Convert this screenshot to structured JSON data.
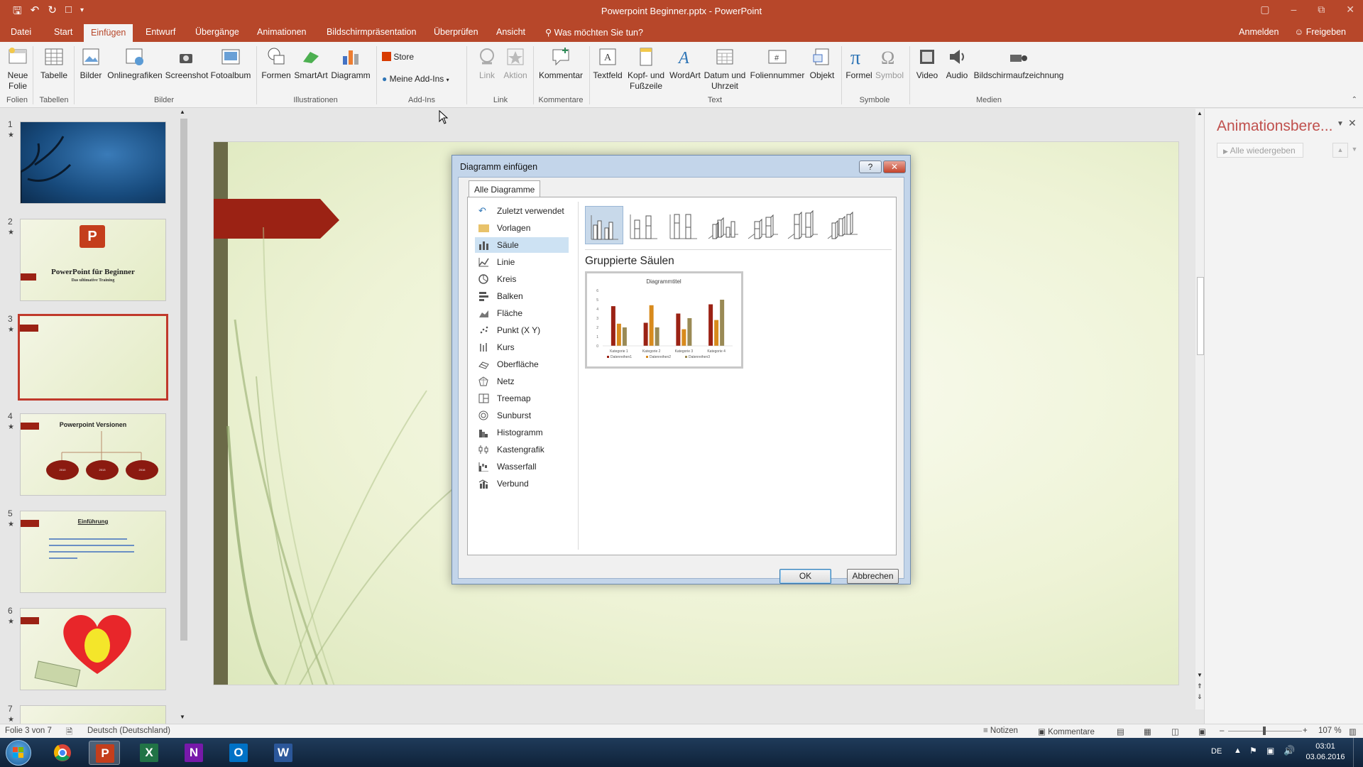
{
  "window": {
    "title": "Powerpoint Beginner.pptx - PowerPoint"
  },
  "tabs": {
    "items": [
      "Datei",
      "Start",
      "Einfügen",
      "Entwurf",
      "Übergänge",
      "Animationen",
      "Bildschirmpräsentation",
      "Überprüfen",
      "Ansicht"
    ],
    "tell_me": "Was möchten Sie tun?",
    "signin": "Anmelden",
    "share": "Freigeben"
  },
  "ribbon": {
    "buttons": {
      "neue_folie": "Neue Folie",
      "tabelle": "Tabelle",
      "bilder": "Bilder",
      "onlinegrafiken": "Onlinegrafiken",
      "screenshot": "Screenshot",
      "fotoalbum": "Fotoalbum",
      "formen": "Formen",
      "smartart": "SmartArt",
      "diagramm": "Diagramm",
      "store": "Store",
      "meine_addins": "Meine Add-Ins",
      "link": "Link",
      "aktion": "Aktion",
      "kommentar": "Kommentar",
      "textfeld": "Textfeld",
      "kopf_fusszeile": "Kopf- und Fußzeile",
      "wordart": "WordArt",
      "datum_uhrzeit": "Datum und Uhrzeit",
      "foliennummer": "Foliennummer",
      "objekt": "Objekt",
      "formel": "Formel",
      "symbol": "Symbol",
      "video": "Video",
      "audio": "Audio",
      "bildschirmaufzeichnung": "Bildschirmaufzeichnung"
    },
    "groups": {
      "folien": "Folien",
      "tabellen": "Tabellen",
      "bilder": "Bilder",
      "illustrationen": "Illustrationen",
      "addins": "Add-Ins",
      "link": "Link",
      "kommentare": "Kommentare",
      "text": "Text",
      "symbole": "Symbole",
      "medien": "Medien"
    }
  },
  "thumbnails": [
    {
      "num": "1"
    },
    {
      "num": "2",
      "title": "PowerPoint für Beginner",
      "subtitle": "Das ultimative Training"
    },
    {
      "num": "3"
    },
    {
      "num": "4",
      "title": "Powerpoint Versionen",
      "nodes": [
        "2010",
        "2013",
        "2016"
      ]
    },
    {
      "num": "5",
      "title": "Einführung"
    },
    {
      "num": "6"
    },
    {
      "num": "7"
    }
  ],
  "animpane": {
    "title": "Animationsbere...",
    "play_all": "Alle wiedergeben"
  },
  "dialog": {
    "title": "Diagramm einfügen",
    "help": "?",
    "tab": "Alle Diagramme",
    "categories": [
      "Zuletzt verwendet",
      "Vorlagen",
      "Säule",
      "Linie",
      "Kreis",
      "Balken",
      "Fläche",
      "Punkt (X Y)",
      "Kurs",
      "Oberfläche",
      "Netz",
      "Treemap",
      "Sunburst",
      "Histogramm",
      "Kastengrafik",
      "Wasserfall",
      "Verbund"
    ],
    "selected_category": "Säule",
    "subtype_title": "Gruppierte Säulen",
    "ok": "OK",
    "cancel": "Abbrechen",
    "preview": {
      "title": "Diagrammtitel",
      "categories": [
        "Kategorie 1",
        "Kategorie 2",
        "Kategorie 3",
        "Kategorie 4"
      ],
      "series": [
        {
          "name": "Datenreihen1",
          "color": "#9b2214",
          "values": [
            4.3,
            2.5,
            3.5,
            4.5
          ]
        },
        {
          "name": "Datenreihen2",
          "color": "#d88a1c",
          "values": [
            2.4,
            4.4,
            1.8,
            2.8
          ]
        },
        {
          "name": "Datenreihen3",
          "color": "#9a8a55",
          "values": [
            2,
            2,
            3,
            5
          ]
        }
      ],
      "yticks": [
        "0",
        "1",
        "2",
        "3",
        "4",
        "5",
        "6"
      ]
    }
  },
  "status": {
    "slide": "Folie 3 von 7",
    "lang": "Deutsch (Deutschland)",
    "notes": "Notizen",
    "comments": "Kommentare",
    "zoom": "107 %"
  },
  "taskbar": {
    "lang": "DE",
    "time": "03:01",
    "date": "03.06.2016"
  },
  "colors": {
    "accent": "#b7472a",
    "dialog_frame": "#c3d5ea"
  }
}
